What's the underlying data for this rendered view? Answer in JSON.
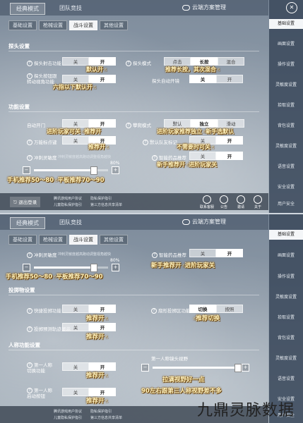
{
  "p1": {
    "tabs": [
      "经典模式",
      "团队竞技"
    ],
    "cloud": "云端方案管理",
    "subtabs": [
      "基础设置",
      "枪械设置",
      "战斗设置",
      "其他设置"
    ],
    "sec1": "探头设置",
    "sec2": "功能设置",
    "rows": {
      "probe_fire": "探头射击功能",
      "probe_mode": "探头模式",
      "probe_switch": "探头按钮跟转动视角功能",
      "probe_auto": "探头自动开镜",
      "auto_door": "自动开门",
      "trip_mode": "攀爬模式",
      "wanneng": "万能标点键",
      "mark_shared": "默认队友标记",
      "snipe": "冲刺灵敏度",
      "snipe_desc": "冲刺灵敏度越高跑动调整视角越快",
      "smart_drug": "智能药品推荐"
    },
    "seg_off": "关",
    "seg_on": "开",
    "probe_mode_opts": [
      "点击",
      "长按",
      "混合"
    ],
    "trip_opts": [
      "默认",
      "独立",
      "滑动"
    ],
    "slider_pct": "80%",
    "slider_value": 80,
    "anns": {
      "a1": "默认开",
      "a2": "推荐长按，其次混合",
      "a3": "六指以下默认开",
      "a4": "进阶玩家可关",
      "a4b": "推荐开",
      "a5": "进阶玩家推荐独立",
      "a5b": "新手选默认",
      "a6": "推荐开",
      "a7": "不需要时可关",
      "a8": "新手推荐开",
      "a8b": "进阶玩家关",
      "a9": "手机推荐50～80",
      "a9b": "平板推荐70～90"
    },
    "right": [
      "基础设置",
      "画面设置",
      "操作设置",
      "灵敏度设置",
      "拾取设置",
      "背包设置",
      "灵敏度设置",
      "语音设置",
      "安全设置",
      "用户安全"
    ],
    "bottom": {
      "logout": "退出登录",
      "t1": "腾讯游戏用户协议",
      "t2": "隐私保护指引",
      "t3": "儿童隐私保护指引",
      "t4": "第三方信息共享清单",
      "icons": [
        "联系客服",
        "公告",
        "邀请",
        "关于"
      ]
    }
  },
  "p2": {
    "tabs": [
      "经典模式",
      "团队竞技"
    ],
    "cloud": "云端方案管理",
    "subtabs": [
      "基础设置",
      "枪械设置",
      "战斗设置",
      "其他设置"
    ],
    "rows": {
      "snipe": "冲刺灵敏度",
      "snipe_desc": "冲刺灵敏度越高跑动调整视角越快",
      "smart_drug": "智能药品推荐",
      "throw": "投掷物设置",
      "quick_throw": "快捷投掷功能",
      "throw_track": "投掷预测轨迹显示",
      "throw_btn": "扇形投掷区功能",
      "fpp": "人称功能设置",
      "fpp_switch": "第一人称切换功能",
      "fpp_fov": "第一人称镜头视野",
      "fpp_last": "第一人称启动按钮"
    },
    "seg_off": "关",
    "seg_on": "开",
    "throw_opts": [
      "切换",
      "按照"
    ],
    "slider_pct": "80%",
    "slider_value": 80,
    "anns": {
      "b1": "新手推荐开",
      "b1b": "进阶玩家关",
      "b2": "手机推荐50～80",
      "b2b": "平板推荐70～90",
      "b3": "推荐开",
      "b4": "推荐开",
      "b5": "推荐切换",
      "b6": "推荐开",
      "b7": "推荐开",
      "b8": "拉满视野好一点",
      "b9": "90左右跟第三人称视野差不多"
    },
    "right": [
      "基础设置",
      "画面设置",
      "操作设置",
      "灵敏度设置",
      "拾取设置",
      "背包设置",
      "灵敏度设置",
      "语音设置",
      "安全设置",
      "用户安全"
    ],
    "bottom": {
      "t1": "腾讯游戏用户协议",
      "t2": "隐私保护指引",
      "t3": "儿童隐私保护指引",
      "t4": "第三方信息共享清单"
    }
  },
  "watermark": "九鼎灵脉数据"
}
